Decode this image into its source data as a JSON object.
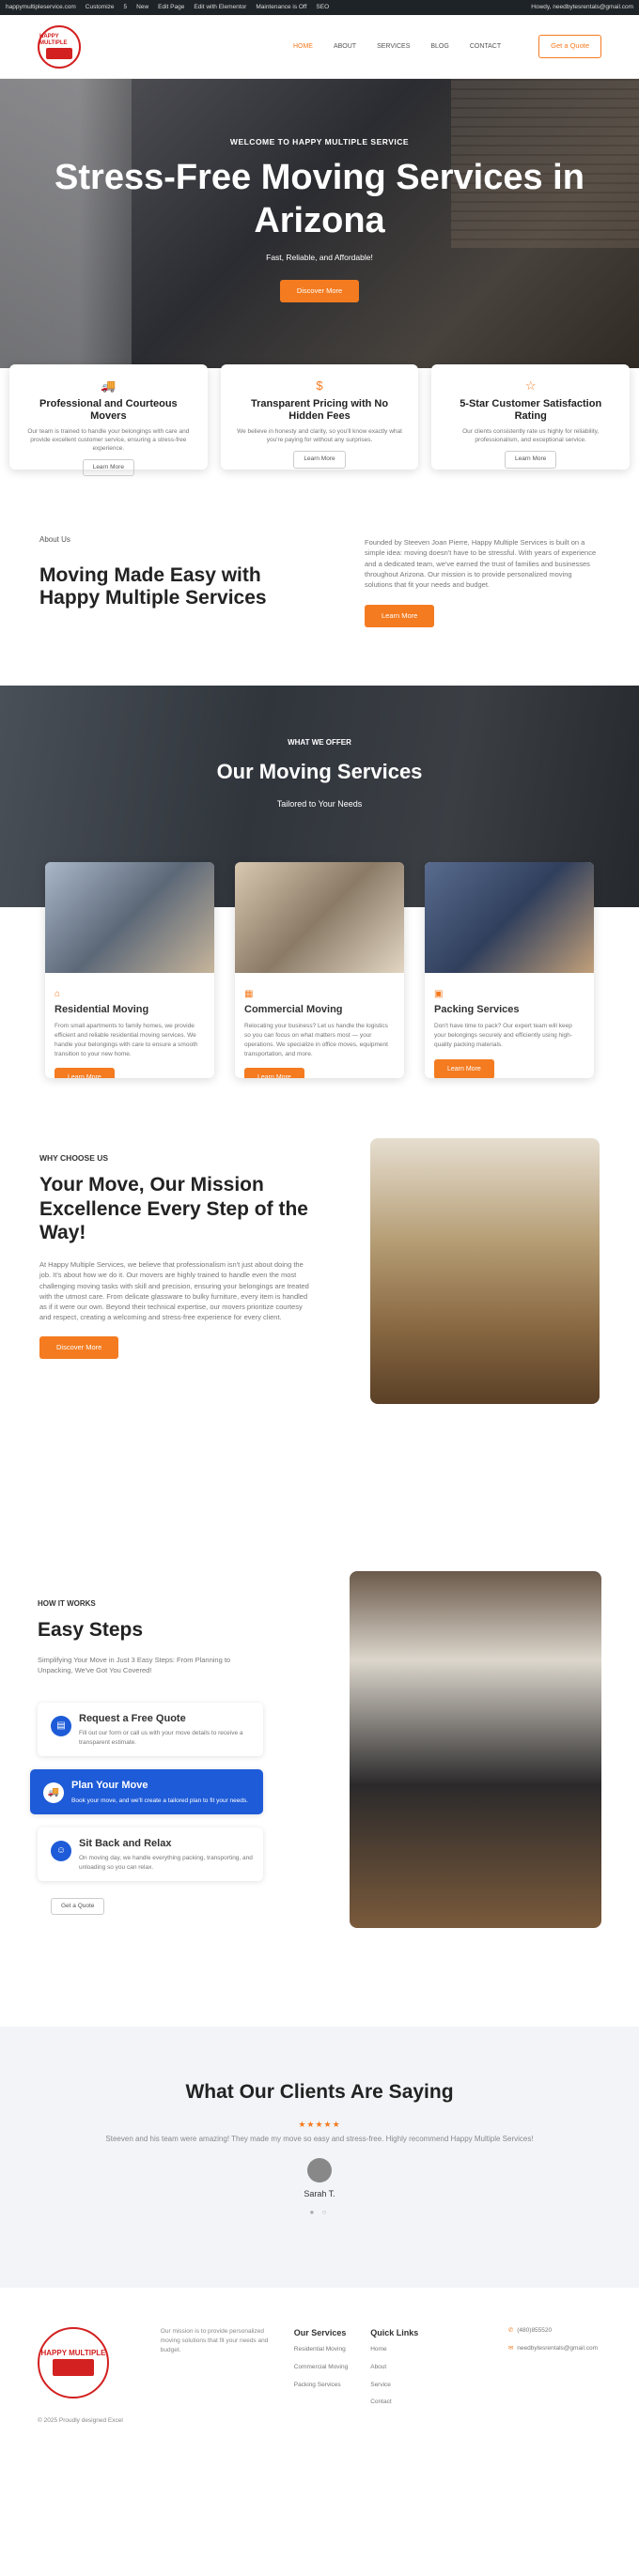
{
  "wp_bar": {
    "site": "happymultipleservice.com",
    "customize": "Customize",
    "updates": "5",
    "new": "New",
    "edit": "Edit Page",
    "elementor": "Edit with Elementor",
    "maintenance": "Maintenance is Off",
    "seo": "SEO",
    "greeting": "Howdy, needbytesrentals@gmail.com"
  },
  "header": {
    "logo_text": "HAPPY MULTIPLE",
    "nav": [
      "HOME",
      "ABOUT",
      "SERVICES",
      "BLOG",
      "CONTACT"
    ],
    "cta": "Get a Quote"
  },
  "hero": {
    "kicker": "WELCOME TO HAPPY MULTIPLE SERVICE",
    "title": "Stress-Free Moving Services in Arizona",
    "subtitle": "Fast, Reliable, and Affordable!",
    "button": "Discover More"
  },
  "features": [
    {
      "title": "Professional and Courteous Movers",
      "text": "Our team is trained to handle your belongings with care and provide excellent customer service, ensuring a stress-free experience.",
      "button": "Learn More"
    },
    {
      "title": "Transparent Pricing with No Hidden Fees",
      "text": "We believe in honesty and clarity, so you'll know exactly what you're paying for without any surprises.",
      "button": "Learn More"
    },
    {
      "title": "5-Star Customer Satisfaction Rating",
      "text": "Our clients consistently rate us highly for reliability, professionalism, and exceptional service.",
      "button": "Learn More"
    }
  ],
  "about": {
    "tag": "About Us",
    "title": "Moving Made Easy with Happy Multiple Services",
    "text": "Founded by Steeven Joan Pierre, Happy Multiple Services is built on a simple idea: moving doesn't have to be stressful. With years of experience and a dedicated team, we've earned the trust of families and businesses throughout Arizona. Our mission is to provide personalized moving solutions that fit your needs and budget.",
    "button": "Learn More"
  },
  "services": {
    "kicker": "WHAT WE OFFER",
    "title": "Our Moving Services",
    "subtitle": "Tailored to Your Needs",
    "cards": [
      {
        "title": "Residential Moving",
        "text": "From small apartments to family homes, we provide efficient and reliable residential moving services. We handle your belongings with care to ensure a smooth transition to your new home.",
        "button": "Learn More"
      },
      {
        "title": "Commercial Moving",
        "text": "Relocating your business? Let us handle the logistics so you can focus on what matters most — your operations. We specialize in office moves, equipment transportation, and more.",
        "button": "Learn More"
      },
      {
        "title": "Packing Services",
        "text": "Don't have time to pack? Our expert team will keep your belongings securely and efficiently using high-quality packing materials.",
        "button": "Learn More"
      }
    ]
  },
  "why": {
    "tag": "WHY CHOOSE US",
    "title": "Your Move, Our Mission Excellence Every Step of the Way!",
    "text": "At Happy Multiple Services, we believe that professionalism isn't just about doing the job. It's about how we do it. Our movers are highly trained to handle even the most challenging moving tasks with skill and precision, ensuring your belongings are treated with the utmost care. From delicate glassware to bulky furniture, every item is handled as if it were our own. Beyond their technical expertise, our movers prioritize courtesy and respect, creating a welcoming and stress-free experience for every client.",
    "button": "Discover More"
  },
  "how": {
    "tag": "HOW IT WORKS",
    "title": "Easy Steps",
    "intro": "Simplifying Your Move in Just 3 Easy Steps: From Planning to Unpacking, We've Got You Covered!",
    "steps": [
      {
        "title": "Request a Free Quote",
        "text": "Fill out our form or call us with your move details to receive a transparent estimate."
      },
      {
        "title": "Plan Your Move",
        "text": "Book your move, and we'll create a tailored plan to fit your needs."
      },
      {
        "title": "Sit Back and Relax",
        "text": "On moving day, we handle everything packing, transporting, and unloading so you can relax."
      }
    ],
    "button": "Get a Quote"
  },
  "testimonials": {
    "title": "What Our Clients Are Saying",
    "stars": "★★★★★",
    "quote": "Steeven and his team were amazing! They made my move so easy and stress-free. Highly recommend Happy Multiple Services!",
    "name": "Sarah T.",
    "dots": "● ○"
  },
  "footer": {
    "mission": "Our mission is to provide personalized moving solutions that fit your needs and budget.",
    "copyright": "© 2025 Proudly designed Excel",
    "services_title": "Our Services",
    "services": [
      "Residential Moving",
      "Commercial Moving",
      "Packing Services"
    ],
    "links_title": "Quick Links",
    "links": [
      "Home",
      "About",
      "Service",
      "Contact"
    ],
    "phone": "(480)855520",
    "email": "needbytesrentals@gmail.com"
  },
  "colors": {
    "accent": "#f47b20",
    "blue": "#1e5bd8",
    "dark": "#222222"
  }
}
